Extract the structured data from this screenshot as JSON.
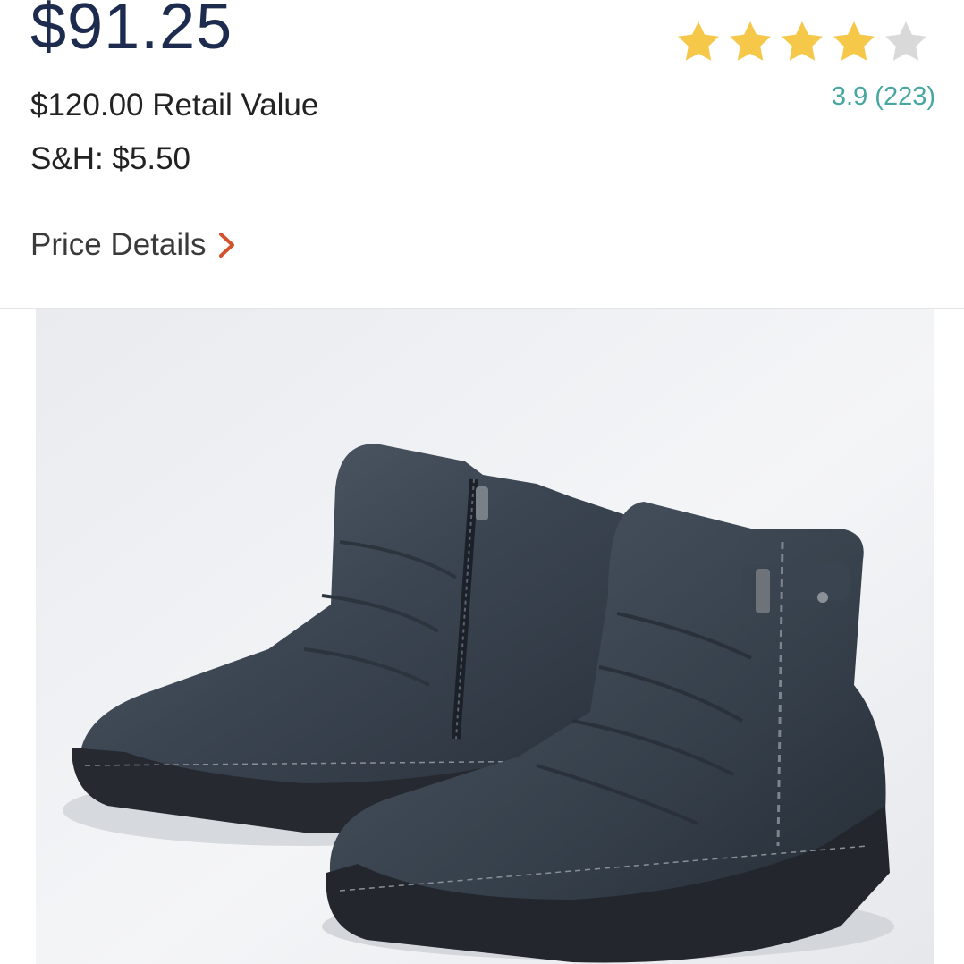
{
  "product": {
    "price": "$91.25",
    "retail_value": "$120.00 Retail Value",
    "shipping": "S&H: $5.50",
    "price_details_label": "Price Details"
  },
  "rating": {
    "stars_filled": 4,
    "stars_total": 5,
    "text": "3.9 (223)"
  },
  "colors": {
    "price": "#1d2b4f",
    "star_filled": "#f5c84a",
    "star_empty": "#d9d9d9",
    "rating_link": "#47a7a0",
    "chevron": "#d2522b"
  },
  "icons": {
    "price_details": "chevron-right-icon",
    "rating": "star-icon"
  }
}
